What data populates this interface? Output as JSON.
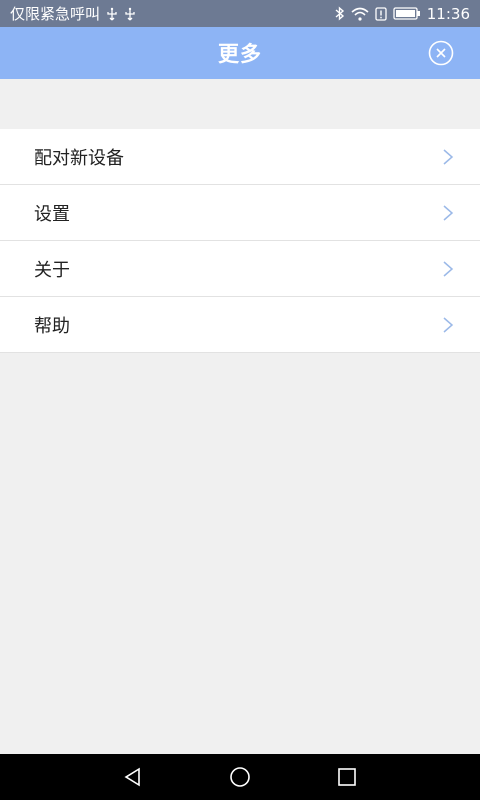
{
  "status_bar": {
    "carrier_text": "仅限紧急呼叫",
    "time": "11:36",
    "icons": [
      "usb-icon",
      "usb-icon",
      "bluetooth-icon",
      "wifi-icon",
      "alert-icon",
      "battery-icon"
    ]
  },
  "header": {
    "title": "更多",
    "close_icon": "close-circle-icon",
    "background_color": "#8db4f5"
  },
  "menu": {
    "items": [
      {
        "label": "配对新设备",
        "icon": "chevron-right-icon"
      },
      {
        "label": "设置",
        "icon": "chevron-right-icon"
      },
      {
        "label": "关于",
        "icon": "chevron-right-icon"
      },
      {
        "label": "帮助",
        "icon": "chevron-right-icon"
      }
    ]
  },
  "nav_bar": {
    "buttons": [
      "back-icon",
      "home-icon",
      "recents-icon"
    ]
  }
}
